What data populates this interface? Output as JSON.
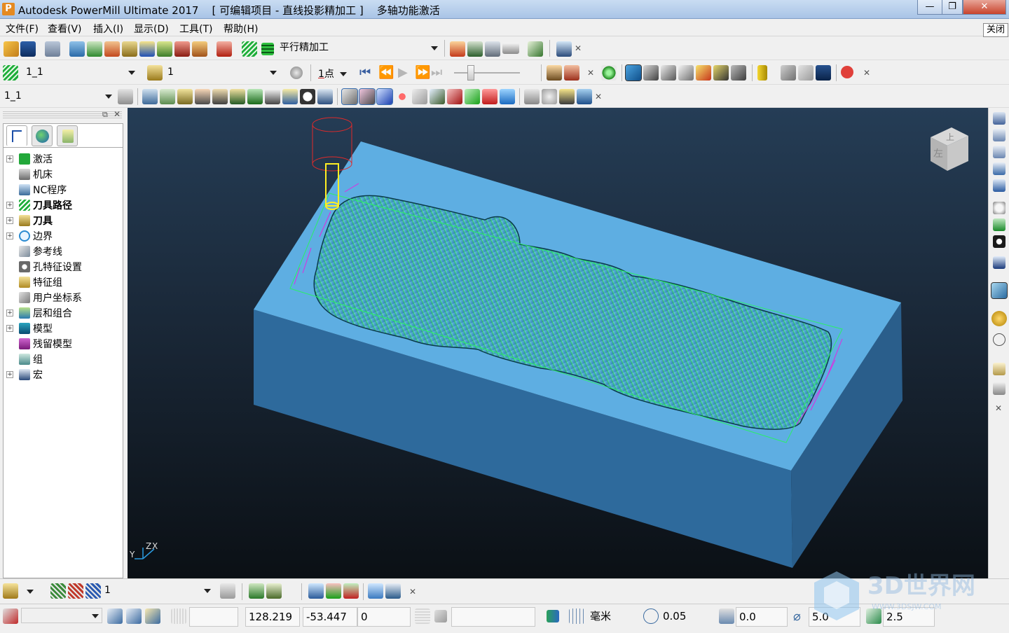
{
  "window": {
    "app_icon": "P",
    "title": "Autodesk PowerMill Ultimate 2017    [ 可编辑项目 - 直线投影精加工 ]    多轴功能激活",
    "minimize": "—",
    "maximize": "❐",
    "close": "✕"
  },
  "menu": {
    "items": [
      "文件(F)",
      "查看(V)",
      "插入(I)",
      "显示(D)",
      "工具(T)",
      "帮助(H)"
    ],
    "close_label": "关闭"
  },
  "toolbar1": {
    "strategy_combo": "平行精加工"
  },
  "toolbar2": {
    "toolpath_combo": "1_1",
    "tool_combo": "1",
    "point_label": "1",
    "point_unit": "点"
  },
  "toolbar3": {
    "workplane_combo": "1_1"
  },
  "explorer": {
    "items": [
      {
        "label": "激活",
        "expandable": true,
        "bold": false,
        "icon": "activate-icon"
      },
      {
        "label": "机床",
        "expandable": false,
        "bold": false,
        "icon": "machine-icon"
      },
      {
        "label": "NC程序",
        "expandable": false,
        "bold": false,
        "icon": "nc-program-icon"
      },
      {
        "label": "刀具路径",
        "expandable": true,
        "bold": true,
        "icon": "toolpath-icon"
      },
      {
        "label": "刀具",
        "expandable": true,
        "bold": true,
        "icon": "tool-icon"
      },
      {
        "label": "边界",
        "expandable": true,
        "bold": false,
        "icon": "boundary-icon"
      },
      {
        "label": "参考线",
        "expandable": false,
        "bold": false,
        "icon": "pattern-icon"
      },
      {
        "label": "孔特征设置",
        "expandable": false,
        "bold": false,
        "icon": "hole-feature-icon"
      },
      {
        "label": "特征组",
        "expandable": false,
        "bold": false,
        "icon": "feature-group-icon"
      },
      {
        "label": "用户坐标系",
        "expandable": false,
        "bold": false,
        "icon": "workplane-icon"
      },
      {
        "label": "层和组合",
        "expandable": true,
        "bold": false,
        "icon": "levels-icon"
      },
      {
        "label": "模型",
        "expandable": true,
        "bold": false,
        "icon": "model-icon"
      },
      {
        "label": "残留模型",
        "expandable": false,
        "bold": false,
        "icon": "stock-model-icon"
      },
      {
        "label": "组",
        "expandable": false,
        "bold": false,
        "icon": "group-icon"
      },
      {
        "label": "宏",
        "expandable": true,
        "bold": false,
        "icon": "macro-icon"
      }
    ]
  },
  "viewport": {
    "axis_x": "X",
    "axis_y": "Y",
    "axis_z": "Z",
    "viewcube_top": "上",
    "viewcube_left": "左"
  },
  "bottom_toolbar": {
    "combo": "1"
  },
  "status": {
    "x": "128.219",
    "y": "-53.447",
    "z": "0",
    "units": "毫米",
    "tolerance": "0.05",
    "thickness": "0.0",
    "diameter": "5.0",
    "stepover": "2.5"
  },
  "watermark": {
    "text": "3D世界网",
    "url": "WWW.3DSJW.COM"
  }
}
